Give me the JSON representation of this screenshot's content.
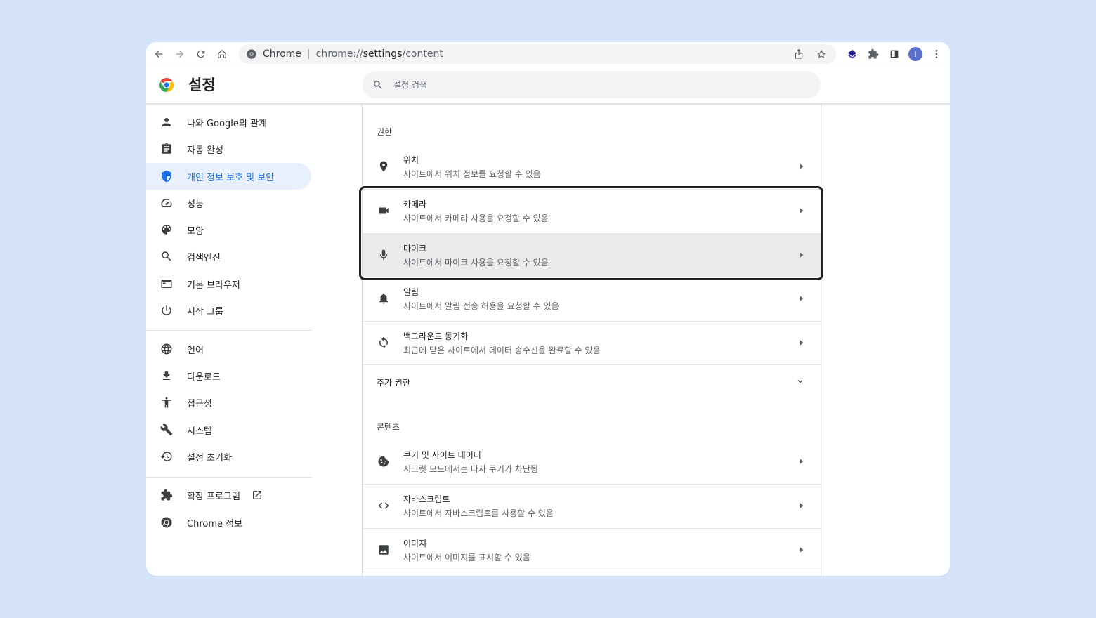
{
  "toolbar": {
    "origin": "Chrome",
    "url_scheme": "chrome://",
    "url_host": "settings",
    "url_path": "/content",
    "avatar_letter": "I"
  },
  "header": {
    "title": "설정",
    "search_placeholder": "설정 검색"
  },
  "sidebar": {
    "items": [
      {
        "label": "나와 Google의 관계",
        "icon": "person-icon"
      },
      {
        "label": "자동 완성",
        "icon": "clipboard-icon"
      },
      {
        "label": "개인 정보 보호 및 보안",
        "icon": "shield-icon",
        "active": true
      },
      {
        "label": "성능",
        "icon": "speedometer-icon"
      },
      {
        "label": "모양",
        "icon": "palette-icon"
      },
      {
        "label": "검색엔진",
        "icon": "search-icon"
      },
      {
        "label": "기본 브라우저",
        "icon": "browser-icon"
      },
      {
        "label": "시작 그룹",
        "icon": "power-icon"
      },
      {
        "label": "언어",
        "icon": "globe-icon"
      },
      {
        "label": "다운로드",
        "icon": "download-icon"
      },
      {
        "label": "접근성",
        "icon": "accessibility-icon"
      },
      {
        "label": "시스템",
        "icon": "wrench-icon"
      },
      {
        "label": "설정 초기화",
        "icon": "history-icon"
      },
      {
        "label": "확장 프로그램",
        "icon": "puzzle-icon"
      },
      {
        "label": "Chrome 정보",
        "icon": "chrome-icon"
      }
    ]
  },
  "permissions": {
    "label": "권한",
    "rows": [
      {
        "title": "위치",
        "desc": "사이트에서 위치 정보를 요청할 수 있음",
        "icon": "location-pin-icon"
      },
      {
        "title": "카메라",
        "desc": "사이트에서 카메라 사용을 요청할 수 있음",
        "icon": "videocam-icon"
      },
      {
        "title": "마이크",
        "desc": "사이트에서 마이크 사용을 요청할 수 있음",
        "icon": "mic-icon"
      },
      {
        "title": "알림",
        "desc": "사이트에서 알림 전송 허용을 요청할 수 있음",
        "icon": "bell-icon"
      },
      {
        "title": "백그라운드 동기화",
        "desc": "최근에 닫은 사이트에서 데이터 송수신을 완료할 수 있음",
        "icon": "sync-icon"
      }
    ],
    "more": "추가 권한"
  },
  "content": {
    "label": "콘텐츠",
    "rows": [
      {
        "title": "쿠키 및 사이트 데이터",
        "desc": "시크릿 모드에서는 타사 쿠키가 차단됨",
        "icon": "cookie-icon"
      },
      {
        "title": "자바스크립트",
        "desc": "사이트에서 자바스크립트를 사용할 수 있음",
        "icon": "code-icon"
      },
      {
        "title": "이미지",
        "desc": "사이트에서 이미지를 표시할 수 있음",
        "icon": "image-icon"
      }
    ]
  },
  "colors": {
    "page_bg": "#d6e4fb",
    "active_bg": "#e8f0fe",
    "active_text": "#1a73e8",
    "highlight_border": "#202124"
  }
}
